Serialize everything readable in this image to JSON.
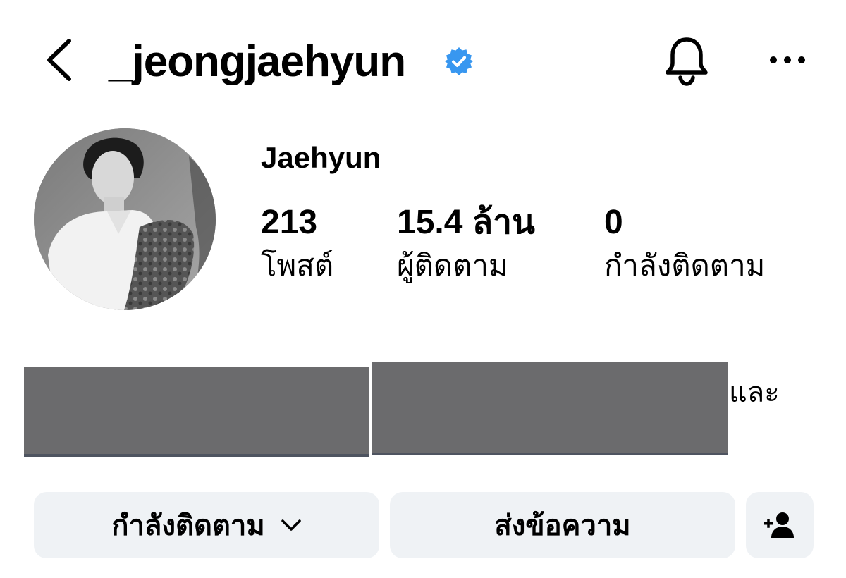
{
  "header": {
    "username": "_jeongjaehyun",
    "icons": {
      "back": "chevron-left-icon",
      "verified": "verified-badge-icon",
      "notifications": "bell-icon",
      "more": "more-dots-icon"
    },
    "accent_color": "#3897f0"
  },
  "profile": {
    "display_name": "Jaehyun",
    "avatar": "profile-photo"
  },
  "stats": [
    {
      "value": "213",
      "label": "โพสต์"
    },
    {
      "value": "15.4 ล้าน",
      "label": "ผู้ติดตาม"
    },
    {
      "value": "0",
      "label": "กำลังติดตาม"
    }
  ],
  "bio": {
    "visible_tail": "และ",
    "redacted": true
  },
  "actions": {
    "following_label": "กำลังติดตาม",
    "message_label": "ส่งข้อความ",
    "suggest_icon": "add-person-icon",
    "button_bg": "#eff2f5"
  }
}
